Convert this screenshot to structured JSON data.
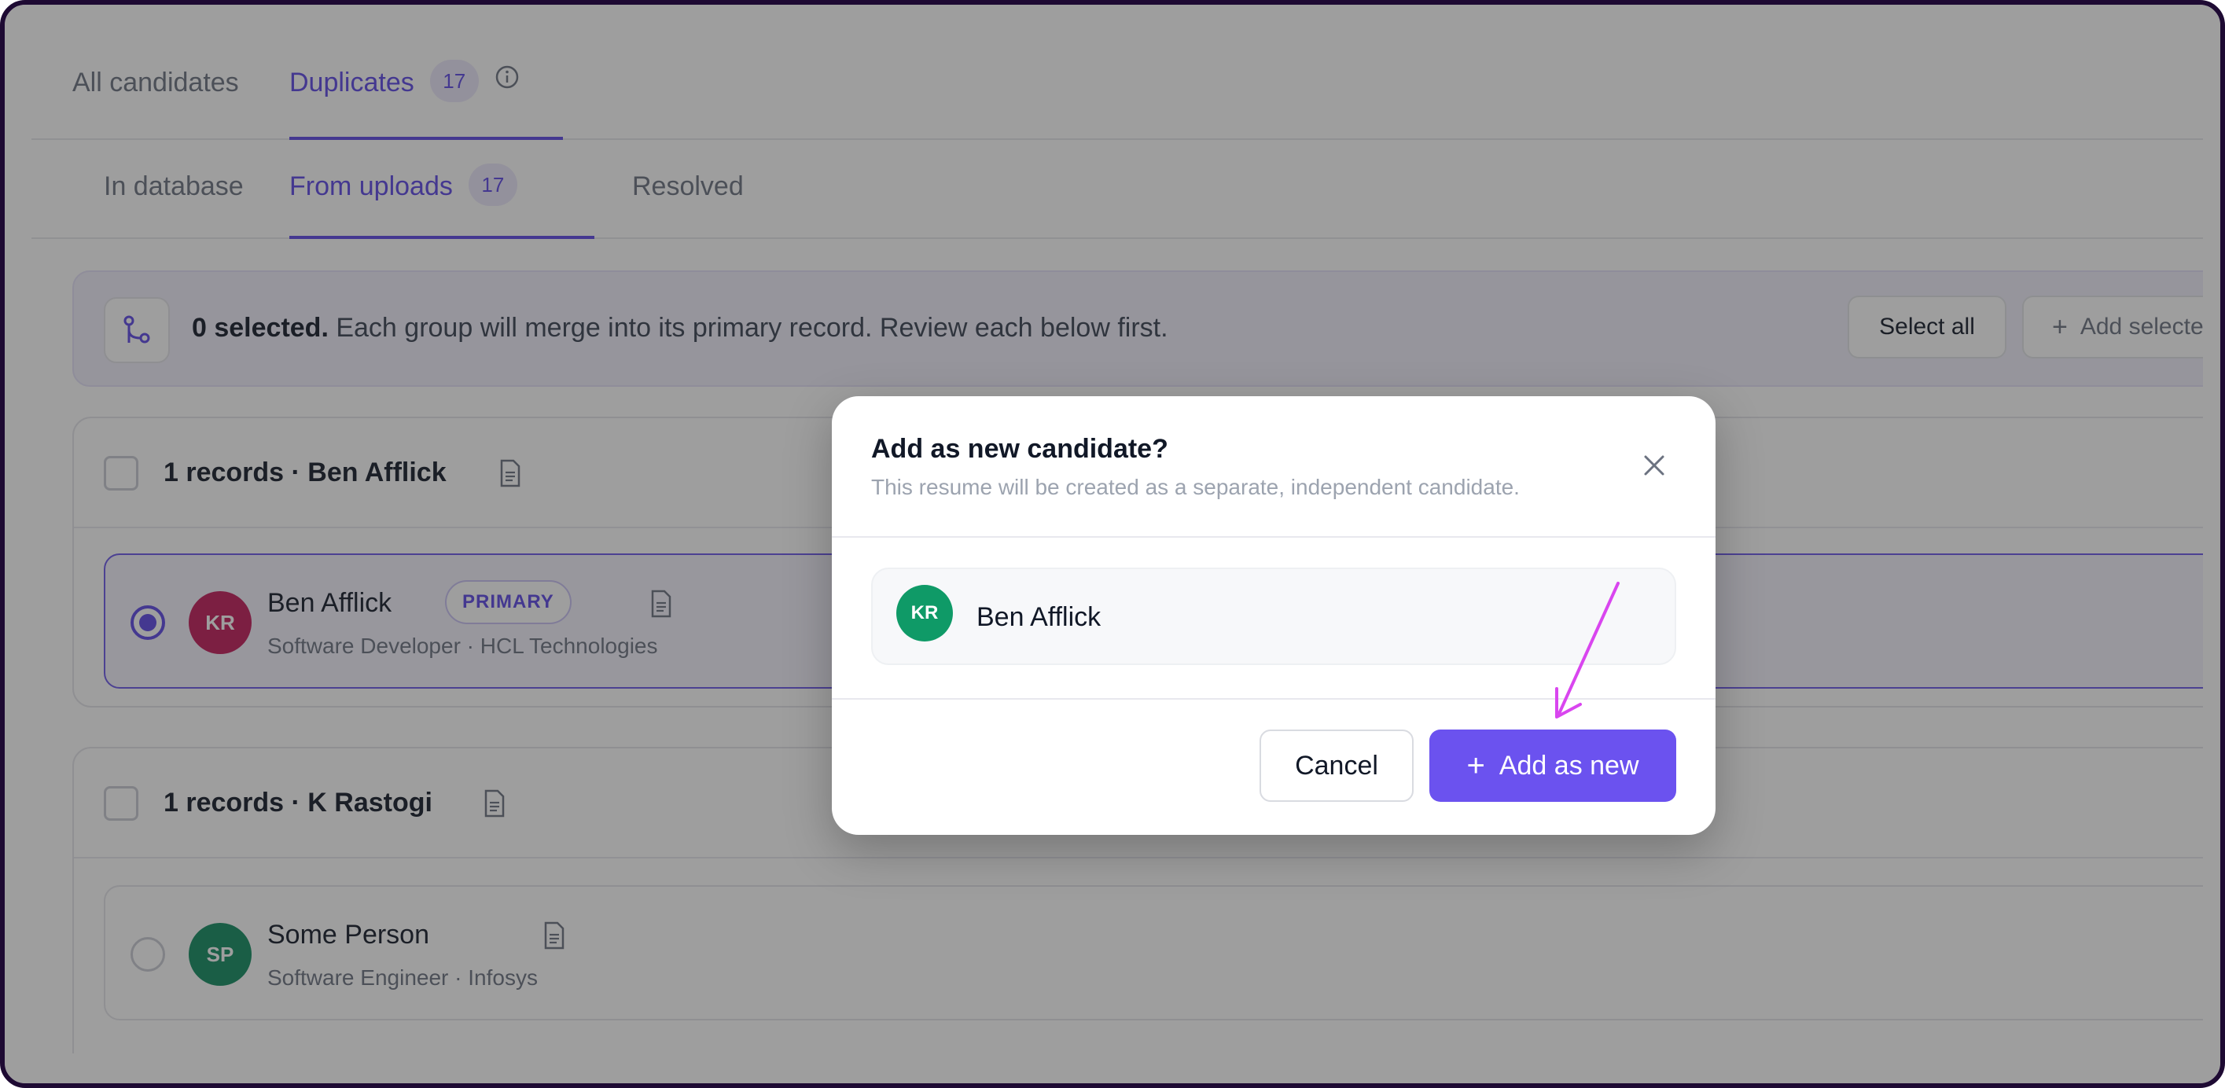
{
  "tabs": {
    "primary": [
      {
        "label": "All candidates"
      },
      {
        "label": "Duplicates",
        "count": "17"
      }
    ],
    "secondary": [
      {
        "label": "In database"
      },
      {
        "label": "From uploads",
        "count": "17"
      },
      {
        "label": "Resolved"
      }
    ]
  },
  "selection_bar": {
    "count_text": "0 selected.",
    "message": "Each group will merge into its primary record. Review each below first.",
    "select_all": "Select all",
    "add_selected": "Add selected a"
  },
  "groups": [
    {
      "title": "1 records · Ben Afflick",
      "record": {
        "initials": "KR",
        "name": "Ben Afflick",
        "badge": "PRIMARY",
        "subtitle": "Software Developer · HCL Technologies",
        "avatar_color": "#c21858",
        "selected": true
      }
    },
    {
      "title": "1 records · K Rastogi",
      "record": {
        "initials": "SP",
        "name": "Some Person",
        "subtitle": "Software Engineer · Infosys",
        "avatar_color": "#0f8a5f",
        "selected": false
      }
    }
  ],
  "modal": {
    "title": "Add as new candidate?",
    "subtitle": "This resume will be created as a separate, independent candidate.",
    "candidate": {
      "initials": "KR",
      "name": "Ben Afflick",
      "avatar_color": "#0f9a67"
    },
    "cancel_label": "Cancel",
    "confirm_label": "Add as new"
  },
  "colors": {
    "accent": "#5b46e6",
    "button": "#6b52ef",
    "annotation": "#d946ef"
  }
}
